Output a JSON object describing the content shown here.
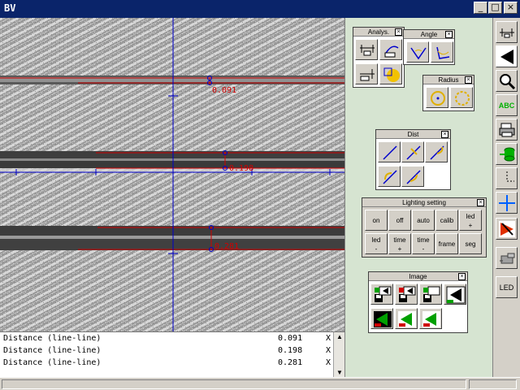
{
  "window": {
    "title": "BV",
    "minimize_glyph": "_",
    "maximize_glyph": "□",
    "close_glyph": "×"
  },
  "measurements": [
    {
      "label": "Distance (line-line)",
      "value": "0.091",
      "flag": "X"
    },
    {
      "label": "Distance (line-line)",
      "value": "0.198",
      "flag": "X"
    },
    {
      "label": "Distance (line-line)",
      "value": "0.281",
      "flag": "X"
    }
  ],
  "overlay_labels": [
    "0.091",
    "0.198",
    "0.281"
  ],
  "palettes": {
    "analysis": {
      "title": "Analys.",
      "close": "×"
    },
    "angle": {
      "title": "Angle",
      "close": "×"
    },
    "radius": {
      "title": "Radius",
      "close": "×"
    },
    "dist": {
      "title": "Dist",
      "close": "×"
    },
    "lighting": {
      "title": "Lighting setting",
      "close": "×",
      "buttons": [
        {
          "l1": "on",
          "l2": ""
        },
        {
          "l1": "off",
          "l2": ""
        },
        {
          "l1": "auto",
          "l2": ""
        },
        {
          "l1": "calib",
          "l2": ""
        },
        {
          "l1": "led",
          "l2": "+"
        },
        {
          "l1": "led",
          "l2": "-"
        },
        {
          "l1": "time",
          "l2": "+"
        },
        {
          "l1": "time",
          "l2": "-"
        },
        {
          "l1": "frame",
          "l2": ""
        },
        {
          "l1": "seg",
          "l2": ""
        }
      ]
    },
    "image": {
      "title": "Image",
      "close": "×"
    }
  },
  "toolbar": {
    "abc_label": "ABC",
    "led_label": "LED"
  },
  "colors": {
    "title_bar": "#0a246a",
    "panel_bg": "#d6e4d1",
    "crosshair": "#0000cc",
    "measure": "#d00000"
  }
}
